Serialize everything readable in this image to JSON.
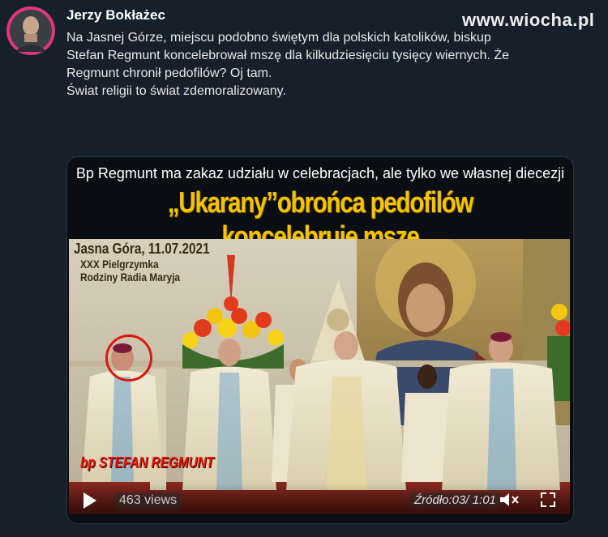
{
  "tweet": {
    "author": "Jerzy Bokłażec",
    "text_lines": [
      "Na Jasnej Górze, miejscu podobno świętym dla polskich katolików, biskup",
      "Stefan Regmunt koncelebrował mszę dla kilkudziesięciu tysięcy wiernych. Że",
      "Regmunt chronił pedofilów? Oj tam.",
      "Świat religii to świat zdemoralizowany."
    ]
  },
  "watermark": "www.wiocha.pl",
  "media": {
    "subtitle": "Bp Regmunt ma zakaz udziału w celebracjach, ale tylko we własnej diecezji",
    "headline": "„Ukarany”obrońca pedofilów koncelebruje mszę",
    "caption": {
      "line1": "Jasna Góra, 11.07.2021",
      "line2": "XXX Pielgrzymka",
      "line3": "Rodziny Radia Maryja"
    },
    "bishop_label": "bp STEFAN REGMUNT",
    "player": {
      "views": "463 views",
      "time": "Źródło:03/ 1:01"
    }
  },
  "colors": {
    "background": "#15202b",
    "headline": "#f4c400",
    "bishop_label": "#e8170b",
    "avatar_ring": "#e0357a"
  }
}
